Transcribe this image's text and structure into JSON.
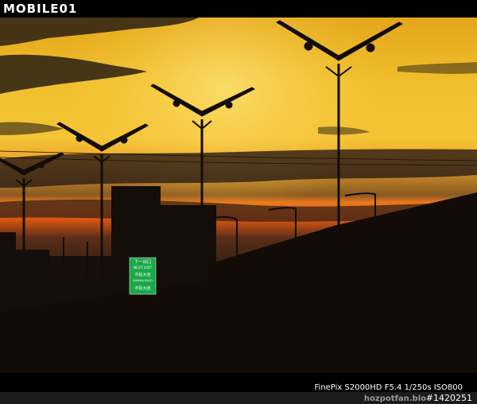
{
  "header": {
    "logo_text": "MOBILE01"
  },
  "photo": {
    "subject": "sunset-skyline-with-wind-turbine-streetlights",
    "sign": {
      "line1": "下一出口",
      "line2": "NEXT EXIT",
      "line3": "市民大道",
      "line4": "SHIMIN BLVD",
      "line5": "市民大道"
    },
    "colors": {
      "sky_top": "#e2a21c",
      "sky_glow": "#f7d040",
      "horizon": "#e85810",
      "silhouette": "#120c08",
      "sign_green": "#1aa84a"
    }
  },
  "footer": {
    "exif": "FinePix S2000HD F5.4 1/250s ISO800",
    "watermark": "hozpotfan.blo",
    "photo_id": "#1420251"
  }
}
